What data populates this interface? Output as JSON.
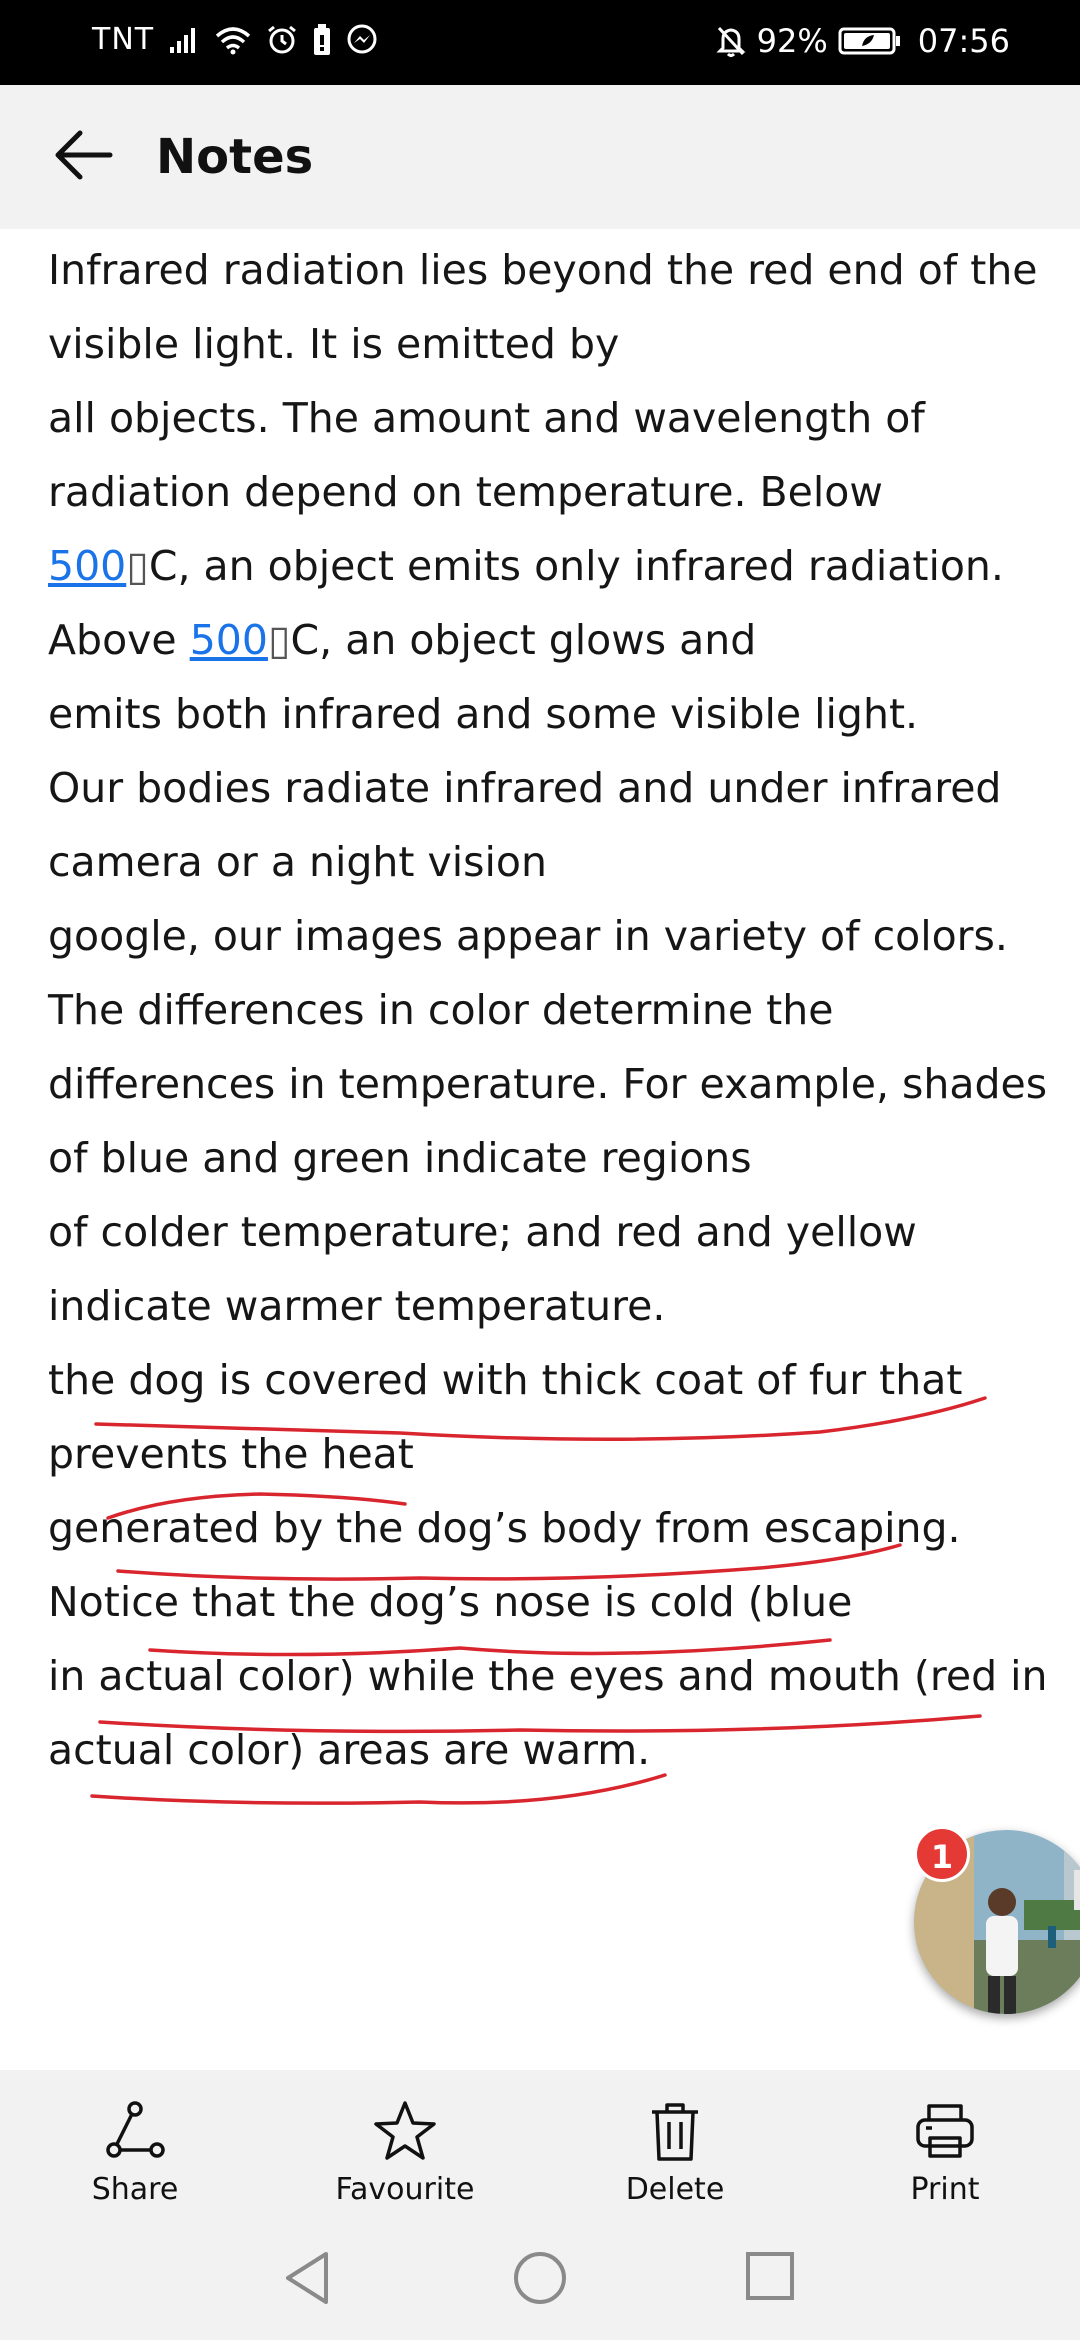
{
  "status_bar": {
    "carrier": "TNT",
    "battery_percent": "92%",
    "time": "07:56",
    "icons": [
      "signal-icon",
      "wifi-icon",
      "alarm-icon",
      "battery-saver-icon",
      "messenger-icon",
      "bell-off-icon",
      "battery-icon"
    ]
  },
  "app_bar": {
    "title": "Notes",
    "back_icon": "arrow-back-icon"
  },
  "note": {
    "lines": [
      {
        "segments": [
          {
            "text": "Infrared radiation lies beyond the red end of the"
          }
        ]
      },
      {
        "segments": [
          {
            "text": "visible light. It is emitted by"
          }
        ]
      },
      {
        "segments": [
          {
            "text": "all objects. The amount and wavelength of"
          }
        ]
      },
      {
        "segments": [
          {
            "text": "radiation depend on temperature. Below"
          }
        ]
      },
      {
        "segments": [
          {
            "text": "500",
            "link": true
          },
          {
            "text": "▯",
            "deg": true
          },
          {
            "text": "C, an object emits only infrared radiation."
          }
        ]
      },
      {
        "segments": [
          {
            "text": "Above "
          },
          {
            "text": "500",
            "link": true
          },
          {
            "text": "▯",
            "deg": true
          },
          {
            "text": "C, an object glows and"
          }
        ]
      },
      {
        "segments": [
          {
            "text": "emits both infrared and some visible light."
          }
        ]
      },
      {
        "segments": [
          {
            "text": "Our bodies radiate infrared and under infrared"
          }
        ]
      },
      {
        "segments": [
          {
            "text": "camera or a night vision"
          }
        ]
      },
      {
        "segments": [
          {
            "text": "google, our images appear in variety of colors."
          }
        ]
      },
      {
        "segments": [
          {
            "text": "The differences in color determine the"
          }
        ]
      },
      {
        "segments": [
          {
            "text": "differences in temperature. For example, shades"
          }
        ]
      },
      {
        "segments": [
          {
            "text": "of blue and green indicate regions"
          }
        ]
      },
      {
        "segments": [
          {
            "text": "of colder temperature; and red and yellow"
          }
        ]
      },
      {
        "segments": [
          {
            "text": "indicate warmer temperature."
          }
        ]
      },
      {
        "segments": [
          {
            "text": "the dog is covered with thick coat of fur that"
          }
        ]
      },
      {
        "segments": [
          {
            "text": "prevents the heat"
          }
        ]
      },
      {
        "segments": [
          {
            "text": "generated by the dog’s body from escaping."
          }
        ]
      },
      {
        "segments": [
          {
            "text": "Notice that the dog’s nose is cold (blue"
          }
        ]
      },
      {
        "segments": [
          {
            "text": "in actual color) while the eyes and mouth (red in"
          }
        ]
      },
      {
        "segments": [
          {
            "text": "actual color) areas are warm."
          }
        ]
      }
    ]
  },
  "colors": {
    "link": "#1a73e8",
    "annotation": "#d9262e",
    "badge": "#e53935"
  },
  "chat_head": {
    "badge_count": "1"
  },
  "toolbar": {
    "items": [
      {
        "label": "Share",
        "icon": "share-icon"
      },
      {
        "label": "Favourite",
        "icon": "star-icon"
      },
      {
        "label": "Delete",
        "icon": "trash-icon"
      },
      {
        "label": "Print",
        "icon": "printer-icon"
      }
    ]
  },
  "nav_bar": {
    "icons": [
      "nav-back-icon",
      "nav-home-icon",
      "nav-recents-icon"
    ]
  }
}
